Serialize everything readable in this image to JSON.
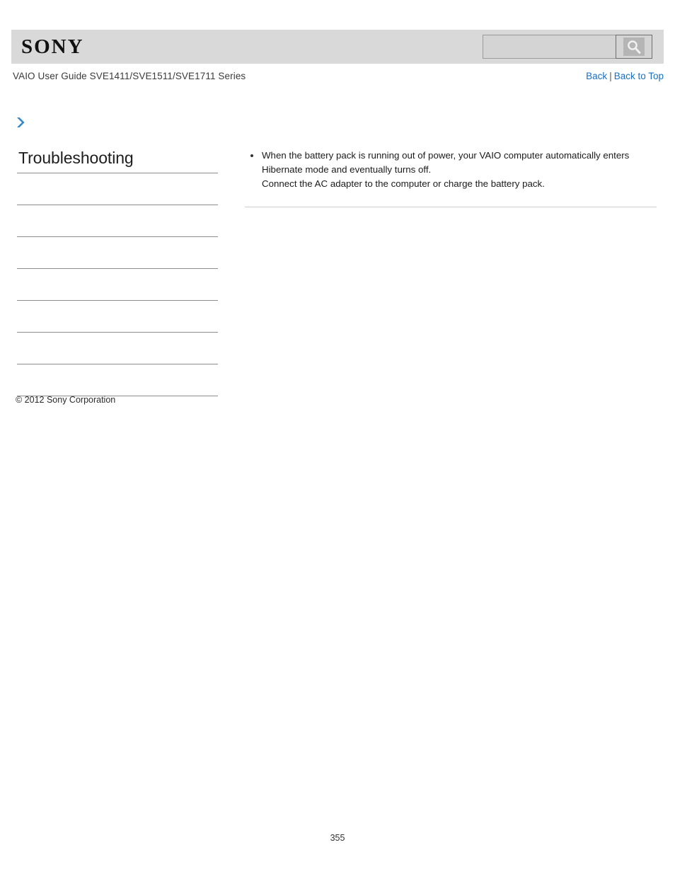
{
  "header": {
    "logo_text": "SONY",
    "search": {
      "value": "",
      "placeholder": "",
      "button_icon": "search-icon"
    }
  },
  "title_row": {
    "guide_title": "VAIO User Guide SVE1411/SVE1511/SVE1711 Series",
    "back_label": "Back",
    "separator": "|",
    "back_to_top_label": "Back to Top"
  },
  "breadcrumb": {
    "icon": "chevron-right-icon",
    "text": ""
  },
  "sidebar": {
    "title": "Troubleshooting",
    "items": [
      {
        "label": ""
      },
      {
        "label": ""
      },
      {
        "label": ""
      },
      {
        "label": ""
      },
      {
        "label": ""
      },
      {
        "label": ""
      },
      {
        "label": ""
      }
    ]
  },
  "main": {
    "bullets": [
      "When the battery pack is running out of power, your VAIO computer automatically enters Hibernate mode and eventually turns off.\nConnect the AC adapter to the computer or charge the battery pack."
    ]
  },
  "footer": {
    "copyright": "© 2012 Sony Corporation",
    "page_number": "355"
  },
  "colors": {
    "header_bar": "#d9d9d9",
    "link_blue": "#1a6fc4",
    "chevron_blue": "#2f86c8",
    "divider": "#8d8d8d",
    "content_rule": "#cfcfcf"
  }
}
